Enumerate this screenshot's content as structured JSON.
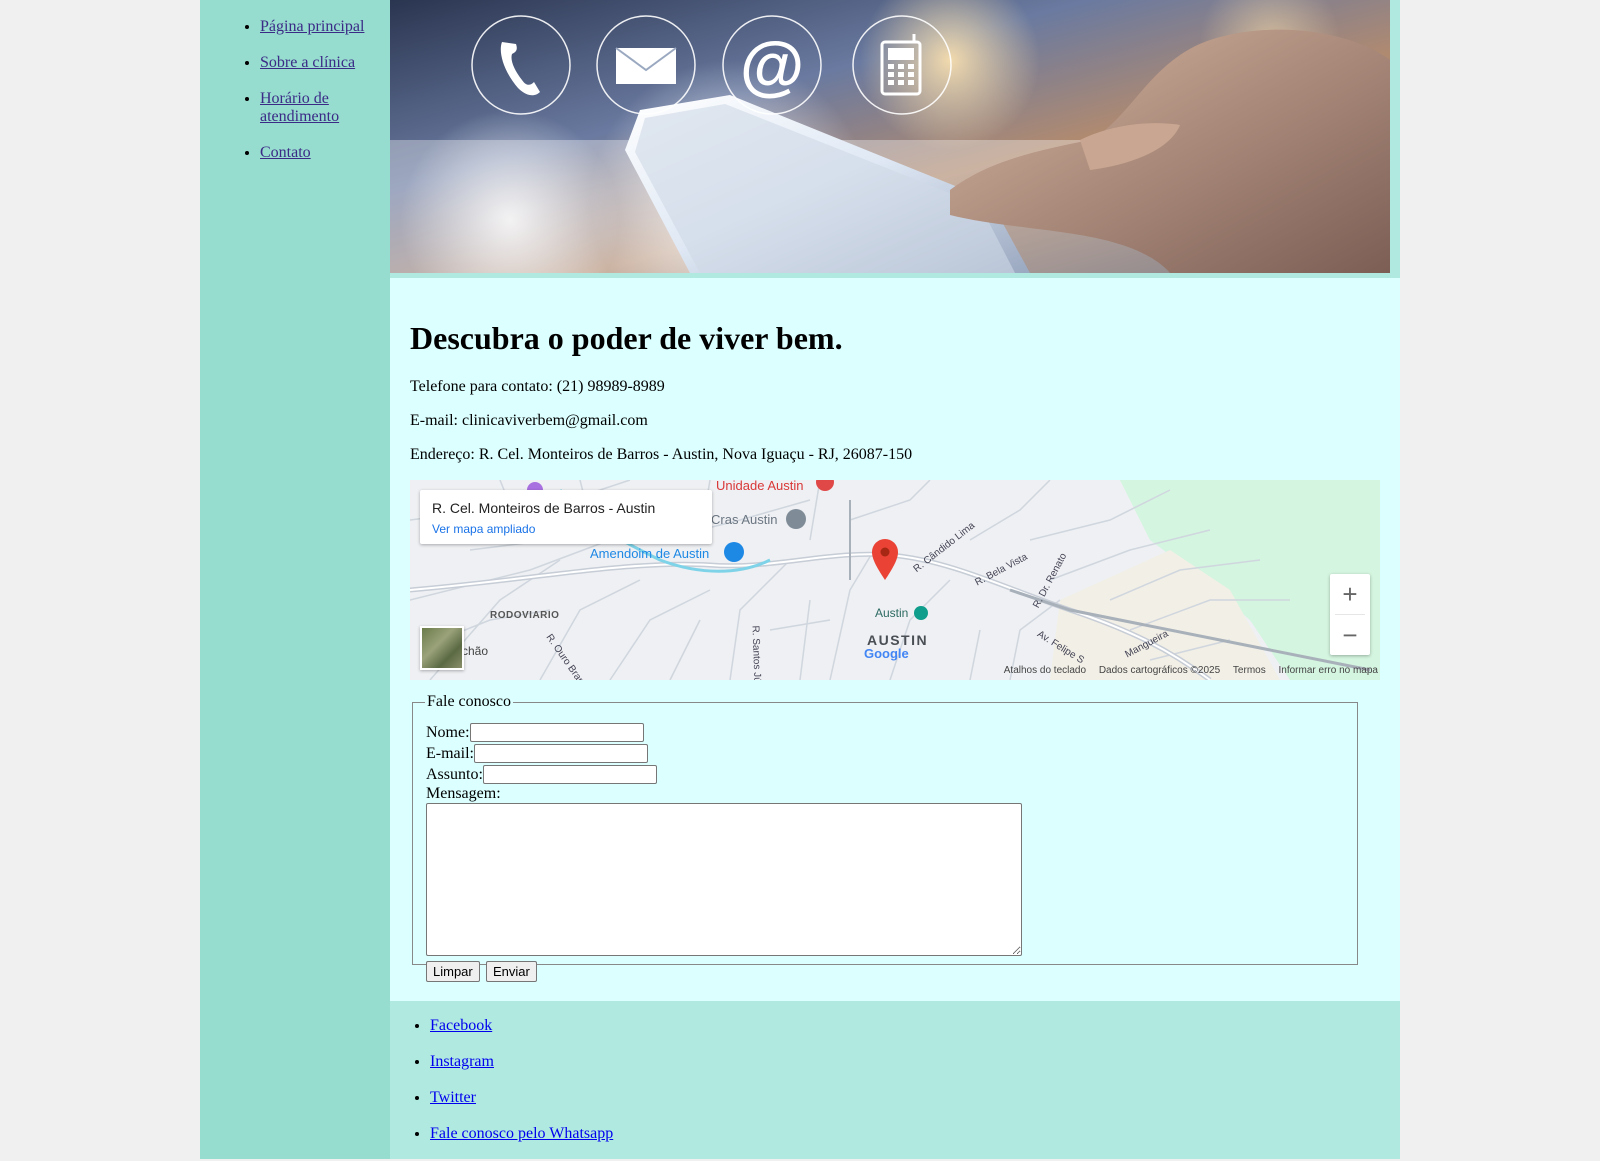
{
  "nav": {
    "items": [
      {
        "label": "Página principal"
      },
      {
        "label": "Sobre a clínica"
      },
      {
        "label": "Horário de atendimento"
      },
      {
        "label": "Contato"
      }
    ]
  },
  "main": {
    "heading": "Descubra o poder de viver bem.",
    "phone": "Telefone para contato: (21) 98989-8989",
    "email": "E-mail: clinicaviverbem@gmail.com",
    "address": "Endereço: R. Cel. Monteiros de Barros - Austin, Nova Iguaçu - RJ, 26087-150"
  },
  "map": {
    "card_title": "R. Cel. Monteiros de Barros - Austin",
    "card_link": "Ver mapa ampliado",
    "labels": {
      "unidade": "Unidade Austin",
      "cras": "Cras Austin",
      "amendoim": "Amendoim de Austin",
      "rodoviario": "RODOVIARIO",
      "austin_station": "Austin",
      "austin_area": "AUSTIN",
      "candido": "R. Cândido Lima",
      "bela_vista": "R. Bela Vista",
      "dr_renato": "R. Dr. Renato",
      "santos_junior": "R. Santos Júnior",
      "ouro_branco": "R. Ouro Branc",
      "felipe": "Av. Felipe S",
      "mangueira": "Mangueira",
      "chao": "chão",
      "google": "Google"
    },
    "attribution": {
      "shortcuts": "Atalhos do teclado",
      "data": "Dados cartográficos ©2025",
      "terms": "Termos",
      "report": "Informar erro no mapa"
    },
    "zoom_in": "+",
    "zoom_out": "−"
  },
  "form": {
    "legend": "Fale conosco",
    "name_label": "Nome:",
    "email_label": "E-mail:",
    "subject_label": "Assunto:",
    "message_label": "Mensagem:",
    "clear_button": "Limpar",
    "send_button": "Enviar"
  },
  "footer": {
    "links": [
      {
        "label": "Facebook"
      },
      {
        "label": "Instagram"
      },
      {
        "label": "Twitter"
      },
      {
        "label": "Fale conosco pelo Whatsapp"
      }
    ]
  },
  "colors": {
    "sidebar": "#96dccf",
    "page": "#afe9df",
    "content": "#dcffff",
    "nav_link": "#3b2a86",
    "footer_link": "#0000ee"
  }
}
